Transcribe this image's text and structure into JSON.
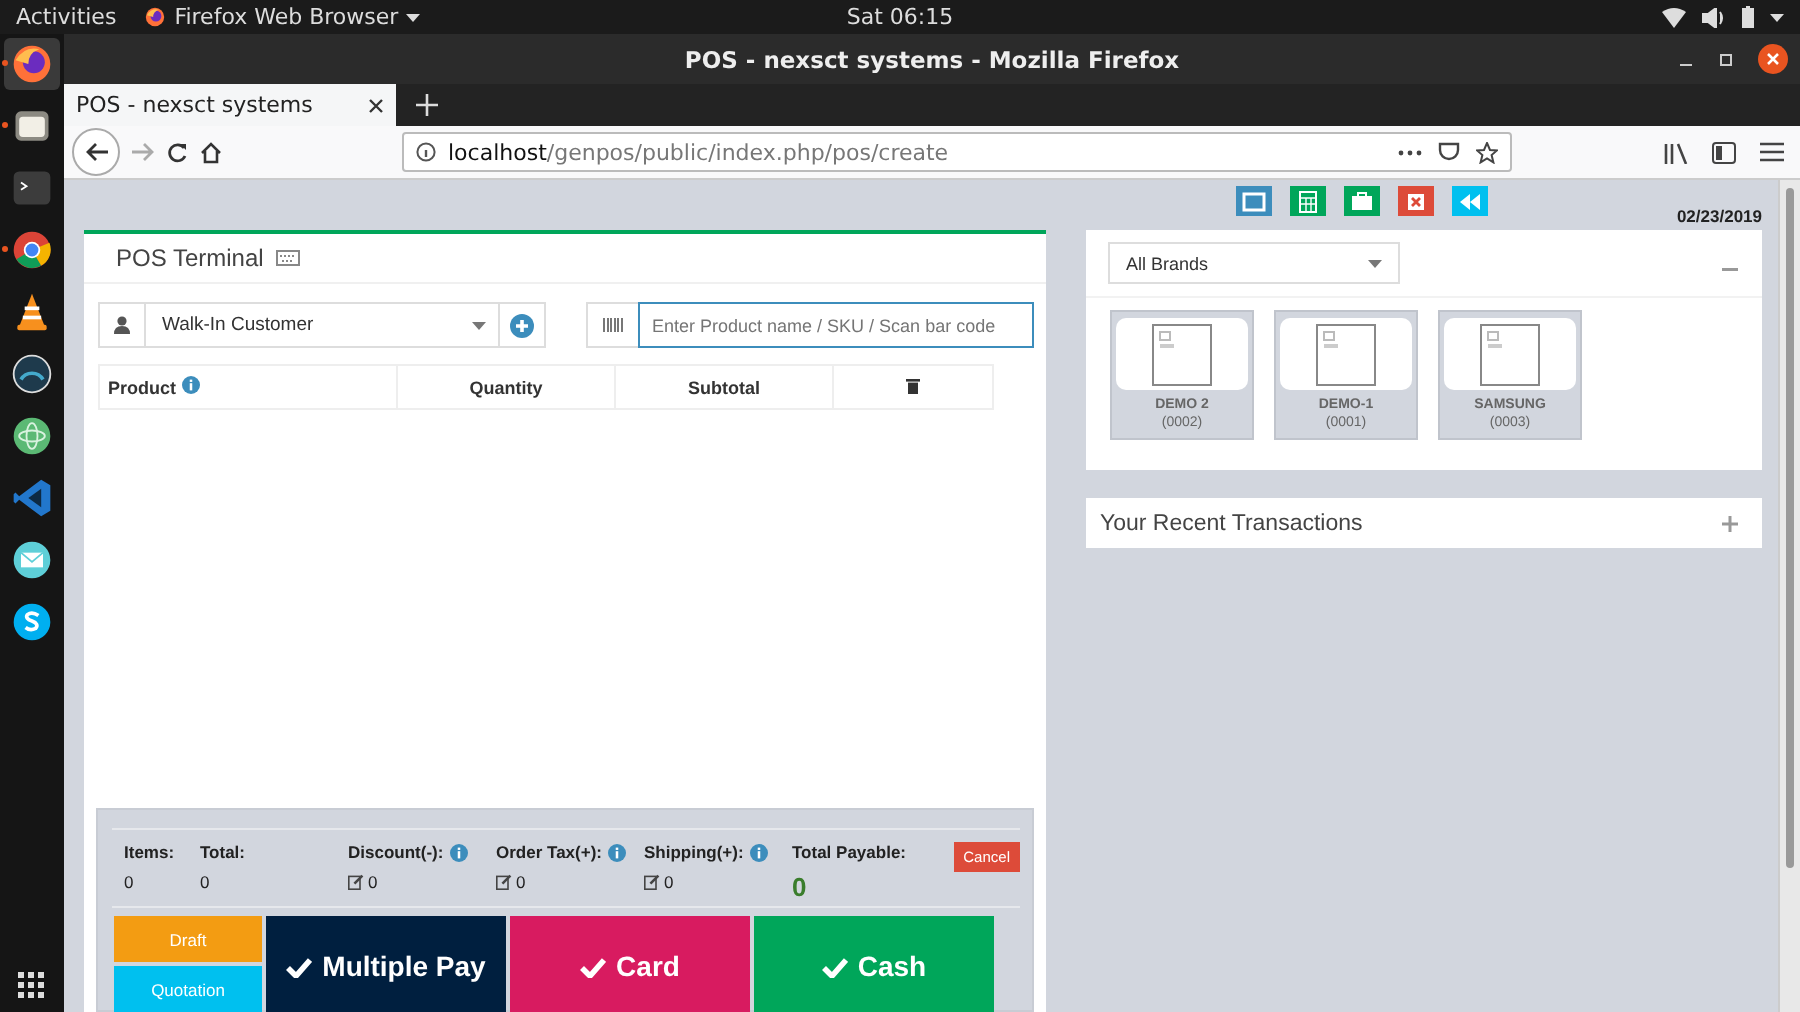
{
  "top_bar": {
    "activities": "Activities",
    "app_menu": "Firefox Web Browser",
    "clock": "Sat 06:15"
  },
  "dock": {
    "items": [
      {
        "kind": "firefox",
        "running": true
      },
      {
        "kind": "files",
        "running": true
      },
      {
        "kind": "terminal",
        "running": false
      },
      {
        "kind": "chrome",
        "running": true
      },
      {
        "kind": "vlc",
        "running": false
      },
      {
        "kind": "gauge",
        "running": false
      },
      {
        "kind": "atom",
        "running": false
      },
      {
        "kind": "code",
        "running": false
      },
      {
        "kind": "mail",
        "running": false
      },
      {
        "kind": "skype",
        "running": false
      }
    ]
  },
  "window": {
    "title": "POS - nexsct systems - Mozilla Firefox"
  },
  "tab": {
    "title": "POS - nexsct systems"
  },
  "url": {
    "host": "localhost",
    "path": "/genpos/public/index.php/pos/create"
  },
  "pos": {
    "title": "POS Terminal",
    "customer": "Walk-In Customer",
    "search": {
      "placeholder": "Enter Product name / SKU / Scan bar code"
    },
    "columns": [
      "Product",
      "Quantity",
      "Subtotal"
    ],
    "totals": [
      {
        "label": "Items:",
        "value": "0",
        "kind": "plain"
      },
      {
        "label": "Total:",
        "value": "0",
        "kind": "plain"
      },
      {
        "label": "Discount(-):",
        "value": "0",
        "kind": "adjustable"
      },
      {
        "label": "Order Tax(+):",
        "value": "0",
        "kind": "adjustable"
      },
      {
        "label": "Shipping(+):",
        "value": "0",
        "kind": "adjustable"
      }
    ],
    "total_payable": {
      "label": "Total Payable:",
      "value": "0"
    },
    "cancel": "Cancel",
    "small_actions": [
      {
        "label": "Draft",
        "kind": "draft"
      },
      {
        "label": "Quotation",
        "kind": "quotation"
      }
    ],
    "pay_buttons": [
      {
        "label": "Multiple Pay",
        "kind": "multiple"
      },
      {
        "label": "Card",
        "kind": "card"
      },
      {
        "label": "Cash",
        "kind": "cash"
      }
    ]
  },
  "right": {
    "date": "02/23/2019",
    "brand_filter": "All Brands",
    "products": [
      {
        "name": "DEMO 2",
        "code": "(0002)"
      },
      {
        "name": "DEMO-1",
        "code": "(0001)"
      },
      {
        "name": "SAMSUNG",
        "code": "(0003)"
      }
    ],
    "recent": "Your Recent Transactions"
  }
}
